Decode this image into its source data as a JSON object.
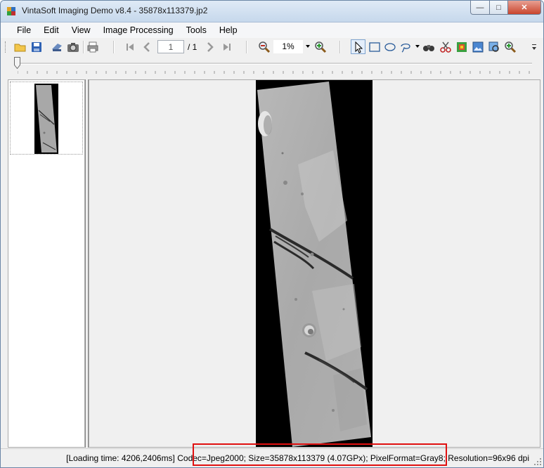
{
  "window": {
    "title": "VintaSoft Imaging Demo v8.4 - 35878x113379.jp2",
    "controls": {
      "minimize": "—",
      "maximize": "□",
      "close": "✕"
    }
  },
  "menu": [
    "File",
    "Edit",
    "View",
    "Image Processing",
    "Tools",
    "Help"
  ],
  "toolbar": {
    "page_current": "1",
    "page_total": "/ 1",
    "zoom": "1%",
    "icons": [
      "open-icon",
      "save-icon",
      "scan-icon",
      "camera-icon",
      "print-icon",
      "first-page-icon",
      "prev-page-icon",
      "next-page-icon",
      "last-page-icon",
      "zoom-out-icon",
      "zoom-in-icon",
      "pointer-icon",
      "rectangle-selection-icon",
      "ellipse-selection-icon",
      "lasso-selection-icon",
      "binoculars-icon",
      "scissors-icon",
      "crop-icon",
      "image-icon",
      "magnifier-icon",
      "zoom-tool-icon"
    ]
  },
  "status": {
    "text": "[Loading time: 4206,2406ms]  Codec=Jpeg2000; Size=35878x113379 (4.07GPx); PixelFormat=Gray8; Resolution=96x96 dpi"
  },
  "colors": {
    "highlight": "#e01010",
    "title_gradient_top": "#dfeaf6",
    "title_gradient_bottom": "#c6d8ec"
  }
}
